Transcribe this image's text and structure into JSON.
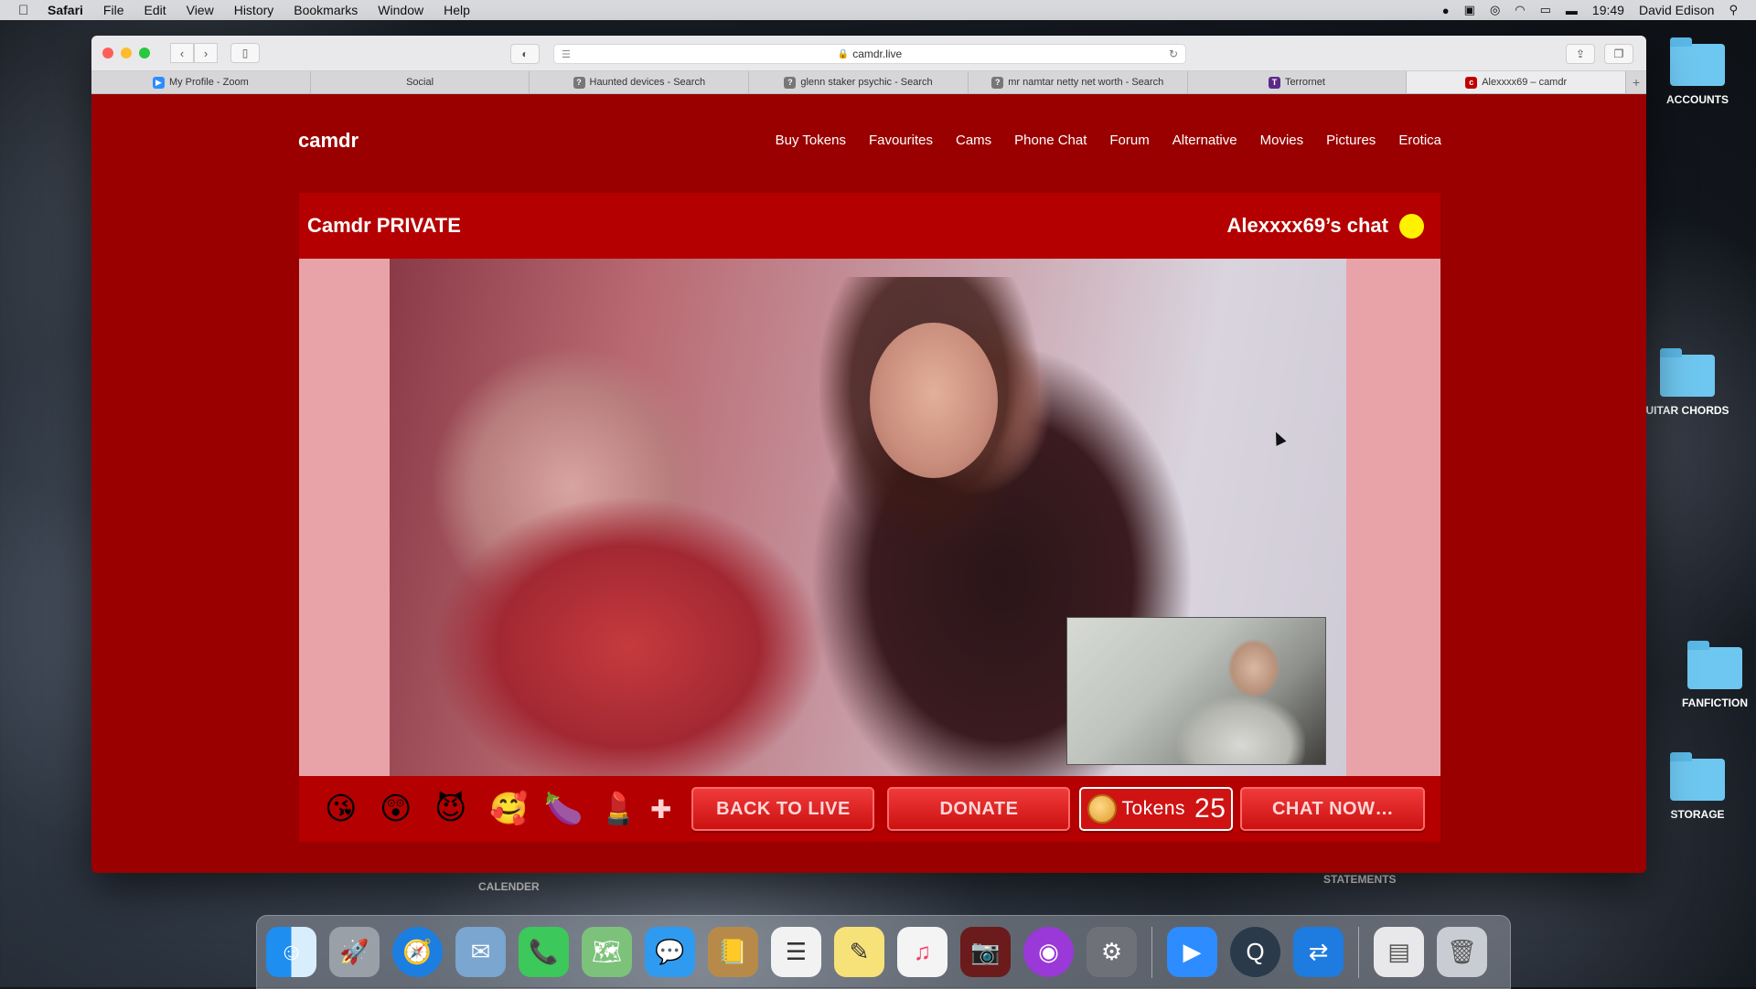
{
  "menubar": {
    "app_name": "Safari",
    "items": [
      "File",
      "Edit",
      "View",
      "History",
      "Bookmarks",
      "Window",
      "Help"
    ],
    "time": "19:49",
    "user": "David Edison",
    "icons": [
      "record-icon",
      "screen-icon",
      "creative-cloud-icon",
      "wifi-icon",
      "airplay-icon",
      "battery-icon",
      "search-icon"
    ]
  },
  "desktop": {
    "folders": [
      {
        "label": "ACCOUNTS"
      },
      {
        "label": "UITAR CHORDS"
      },
      {
        "label": "FANFICTION"
      },
      {
        "label": "STORAGE"
      }
    ],
    "labels": [
      "CALENDER",
      "STATEMENTS"
    ]
  },
  "browser": {
    "url": "camdr.live",
    "tabs": [
      {
        "label": "My Profile - Zoom",
        "icon": "zoom-icon",
        "color": "#2d8cff"
      },
      {
        "label": "Social",
        "icon": "",
        "color": ""
      },
      {
        "label": "Haunted devices - Search",
        "icon": "question-icon",
        "color": "#777777"
      },
      {
        "label": "glenn staker psychic - Search",
        "icon": "question-icon",
        "color": "#777777"
      },
      {
        "label": "mr namtar netty net worth - Search",
        "icon": "question-icon",
        "color": "#777777"
      },
      {
        "label": "Terrornet",
        "icon": "terrornet-icon",
        "color": "#5b2a86"
      },
      {
        "label": "Alexxxx69 – camdr",
        "icon": "camdr-icon",
        "color": "#c00000"
      }
    ]
  },
  "site": {
    "logo": "camdr",
    "nav": [
      "Buy Tokens",
      "Favourites",
      "Cams",
      "Phone Chat",
      "Forum",
      "Alternative",
      "Movies",
      "Pictures",
      "Erotica"
    ],
    "panel_title": "Camdr PRIVATE",
    "chat_user": "Alexxxx69’s chat",
    "emojis": [
      "😘",
      "😲",
      "😈",
      "🥰",
      "🍆",
      "💄"
    ],
    "plus": "✚",
    "back_label": "BACK TO LIVE",
    "donate_label": "DONATE",
    "tokens_label": "Tokens",
    "tokens_count": "25",
    "chat_label": "CHAT NOW…",
    "colors": {
      "page": "#9a0000",
      "panel": "#b40000",
      "side": "#e8a3a8",
      "status": "#fff200"
    }
  },
  "dock": [
    "finder-icon",
    "launchpad-icon",
    "safari-icon",
    "mail-icon",
    "facetime-icon",
    "maps-icon",
    "messages-icon",
    "contacts-icon",
    "reminders-icon",
    "notes-icon",
    "music-icon",
    "photo-booth-icon",
    "podcasts-icon",
    "system-preferences-icon",
    "zoom-icon",
    "quicktime-icon",
    "teamviewer-icon",
    "downloads-icon",
    "trash-icon"
  ]
}
